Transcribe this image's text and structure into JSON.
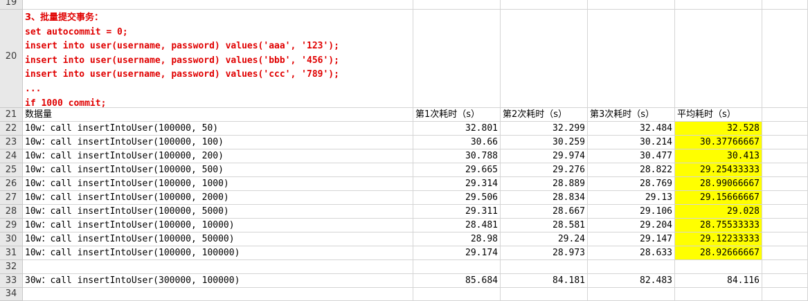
{
  "colors": {
    "highlight": "#ffff00",
    "sql_text": "#e00000",
    "row_header_bg": "#e8e8e8"
  },
  "rows": {
    "r19": "19",
    "r20": "20",
    "r21": "21",
    "r32": "32",
    "r33": "33",
    "r34": "34"
  },
  "sql_block": {
    "title": "3、批量提交事务：",
    "lines": [
      "set autocommit = 0;",
      "insert into user(username, password) values('aaa', '123');",
      "insert into user(username, password) values('bbb', '456');",
      "insert into user(username, password) values('ccc', '789');",
      "...",
      "if 1000 commit;"
    ]
  },
  "header": {
    "col_a": "数据量",
    "col_b": "第1次耗时（s）",
    "col_c": "第2次耗时（s）",
    "col_d": "第3次耗时（s）",
    "col_e": "平均耗时（s）"
  },
  "data_rows": [
    {
      "row": "22",
      "label": "10w：call insertIntoUser(100000, 50)",
      "t1": "32.801",
      "t2": "32.299",
      "t3": "32.484",
      "avg": "32.528"
    },
    {
      "row": "23",
      "label": "10w：call insertIntoUser(100000, 100)",
      "t1": "30.66",
      "t2": "30.259",
      "t3": "30.214",
      "avg": "30.37766667"
    },
    {
      "row": "24",
      "label": "10w：call insertIntoUser(100000, 200)",
      "t1": "30.788",
      "t2": "29.974",
      "t3": "30.477",
      "avg": "30.413"
    },
    {
      "row": "25",
      "label": "10w：call insertIntoUser(100000, 500)",
      "t1": "29.665",
      "t2": "29.276",
      "t3": "28.822",
      "avg": "29.25433333"
    },
    {
      "row": "26",
      "label": "10w：call insertIntoUser(100000, 1000)",
      "t1": "29.314",
      "t2": "28.889",
      "t3": "28.769",
      "avg": "28.99066667"
    },
    {
      "row": "27",
      "label": "10w：call insertIntoUser(100000, 2000)",
      "t1": "29.506",
      "t2": "28.834",
      "t3": "29.13",
      "avg": "29.15666667"
    },
    {
      "row": "28",
      "label": "10w：call insertIntoUser(100000, 5000)",
      "t1": "29.311",
      "t2": "28.667",
      "t3": "29.106",
      "avg": "29.028"
    },
    {
      "row": "29",
      "label": "10w：call insertIntoUser(100000, 10000)",
      "t1": "28.481",
      "t2": "28.581",
      "t3": "29.204",
      "avg": "28.75533333"
    },
    {
      "row": "30",
      "label": "10w：call insertIntoUser(100000, 50000)",
      "t1": "28.98",
      "t2": "29.24",
      "t3": "29.147",
      "avg": "29.12233333"
    },
    {
      "row": "31",
      "label": "10w：call insertIntoUser(100000, 100000)",
      "t1": "29.174",
      "t2": "28.973",
      "t3": "28.633",
      "avg": "28.92666667"
    }
  ],
  "summary_row": {
    "label": "30w：call insertIntoUser(300000, 100000)",
    "t1": "85.684",
    "t2": "84.181",
    "t3": "82.483",
    "avg": "84.116"
  }
}
